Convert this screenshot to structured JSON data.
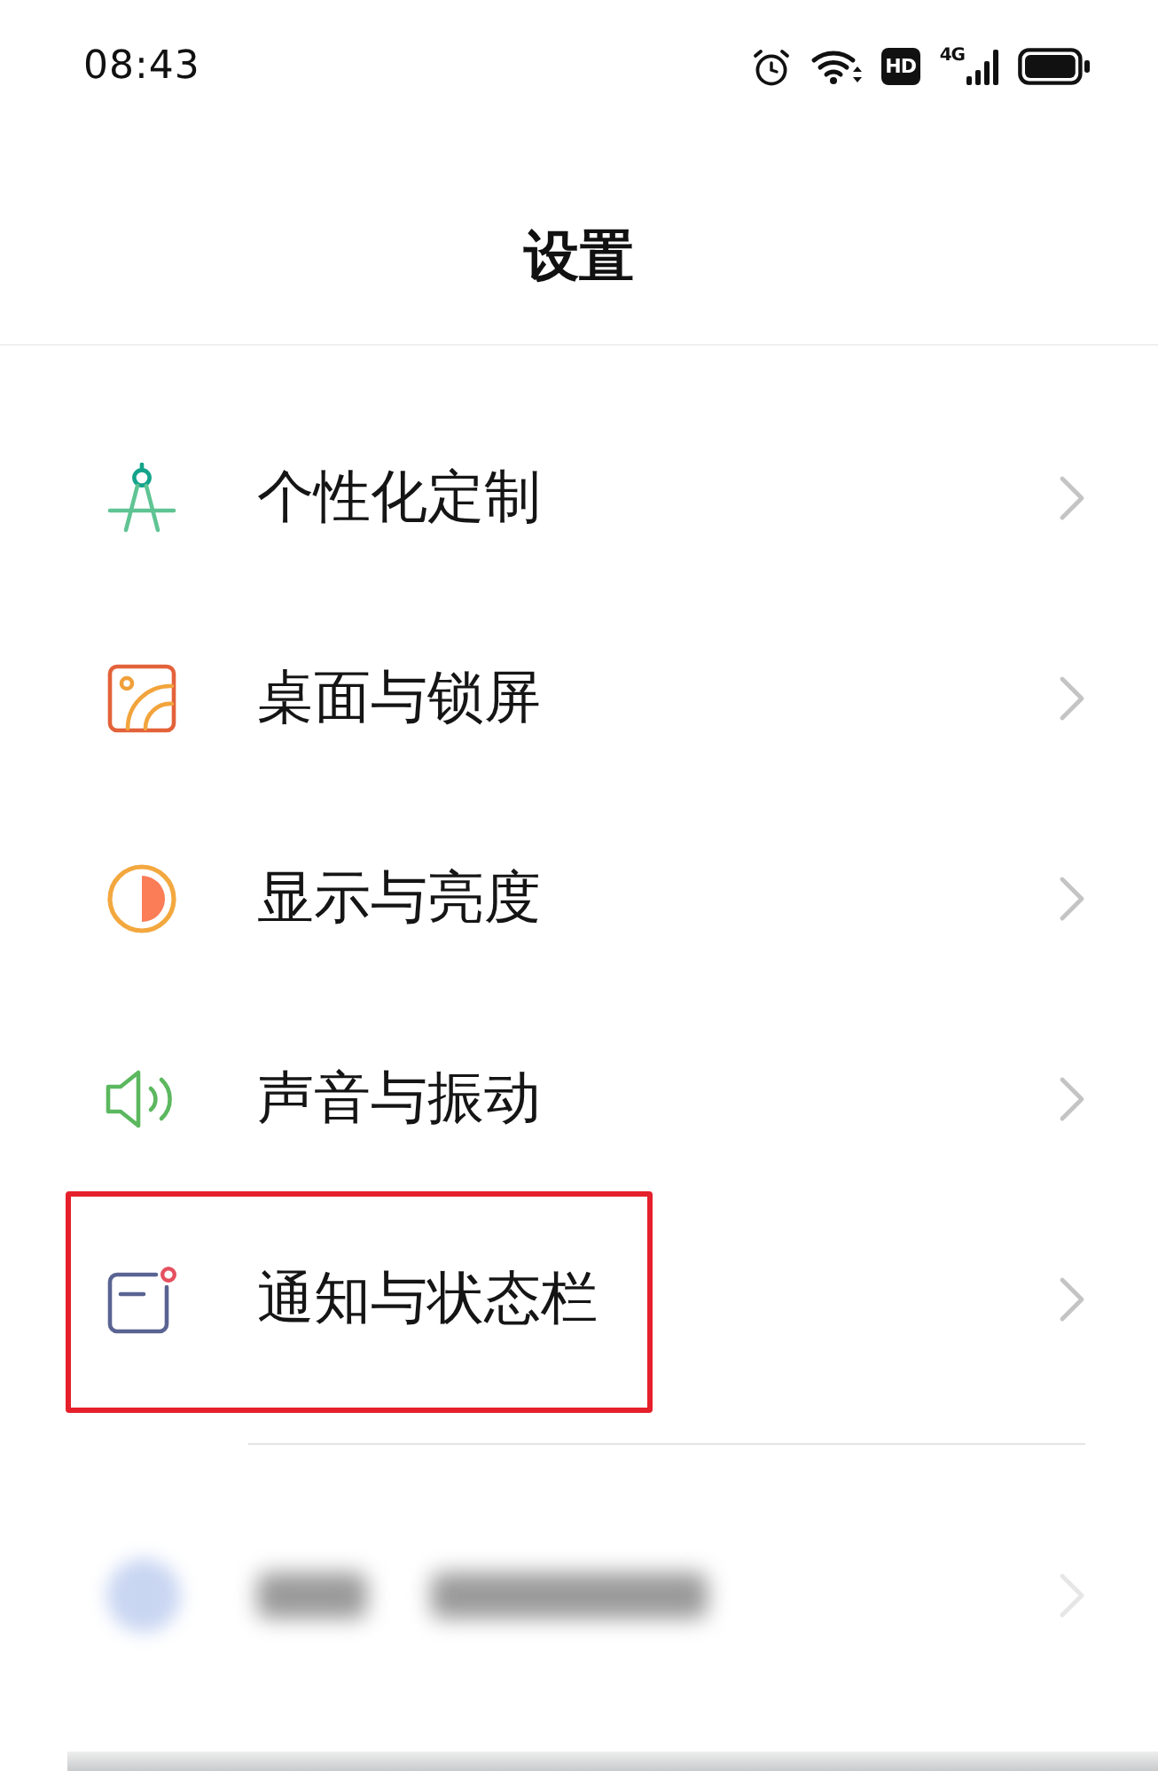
{
  "status_bar": {
    "time": "08:43",
    "hd_label": "HD",
    "network_label": "4G"
  },
  "title": "设置",
  "groups": [
    {
      "items": [
        {
          "kind": "setting",
          "label": "个性化定制",
          "highlighted": false
        },
        {
          "kind": "setting",
          "label": "桌面与锁屏",
          "highlighted": false
        },
        {
          "kind": "setting",
          "label": "显示与亮度",
          "highlighted": false
        },
        {
          "kind": "setting",
          "label": "声音与振动",
          "highlighted": false
        },
        {
          "kind": "setting",
          "label": "通知与状态栏",
          "highlighted": true
        }
      ]
    },
    {
      "items": [
        {
          "kind": "blurred"
        },
        {
          "kind": "partial"
        }
      ]
    }
  ]
}
